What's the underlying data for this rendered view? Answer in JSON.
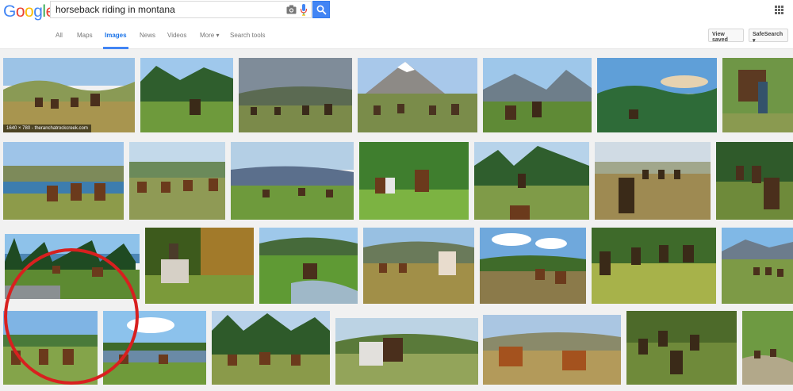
{
  "logo": {
    "letters": [
      "G",
      "o",
      "o",
      "g",
      "l",
      "e"
    ],
    "colors": [
      "#4285f4",
      "#ea4335",
      "#fbbc05",
      "#4285f4",
      "#34a853",
      "#ea4335"
    ]
  },
  "search": {
    "query": "horseback riding in montana",
    "camera_icon": "camera-icon",
    "mic_icon": "mic-icon",
    "search_icon": "magnifier-icon"
  },
  "apps_icon": "apps-grid-icon",
  "tabs": [
    {
      "label": "All"
    },
    {
      "label": "Maps"
    },
    {
      "label": "Images",
      "active": true
    },
    {
      "label": "News"
    },
    {
      "label": "Videos"
    },
    {
      "label": "More ▾"
    },
    {
      "label": "Search tools"
    }
  ],
  "toolbar": {
    "view_saved": "View saved",
    "safesearch": "SafeSearch ▾"
  },
  "images": {
    "first_caption": "1640 × 780 - theranchatrockcreek.com"
  },
  "annotation": {
    "color": "#d8201f"
  }
}
